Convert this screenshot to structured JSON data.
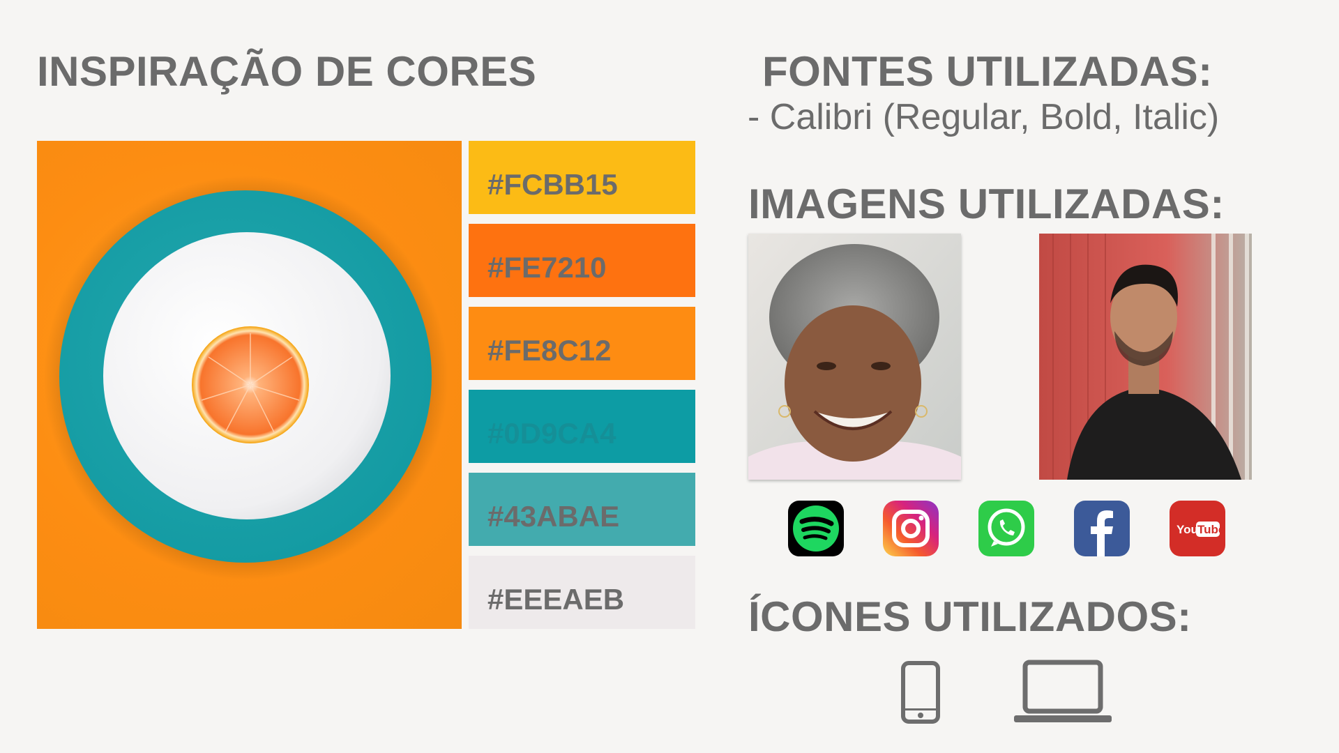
{
  "left": {
    "title": "INSPIRAÇÃO DE CORES"
  },
  "swatches": [
    {
      "label": "#FCBB15",
      "color": "#FCBB15"
    },
    {
      "label": "#FE7210",
      "color": "#FE7210"
    },
    {
      "label": "#FE8C12",
      "color": "#FE8C12"
    },
    {
      "label": "#0D9CA4",
      "color": "#0D9CA4"
    },
    {
      "label": "#43ABAE",
      "color": "#43ABAE"
    },
    {
      "label": "#EEEAEB",
      "color": "#EEEAEB"
    }
  ],
  "fonts": {
    "title": "FONTES UTILIZADAS:",
    "line": "- Calibri (Regular, Bold, Italic)"
  },
  "images": {
    "title": "IMAGENS UTILIZADAS:"
  },
  "social_icons": [
    "spotify-icon",
    "instagram-icon",
    "whatsapp-icon",
    "facebook-icon",
    "youtube-icon"
  ],
  "youtube_text": {
    "you": "You",
    "tube": "Tube"
  },
  "icons": {
    "title": "ÍCONES UTILIZADOS:",
    "items": [
      "smartphone-icon",
      "laptop-icon"
    ]
  }
}
